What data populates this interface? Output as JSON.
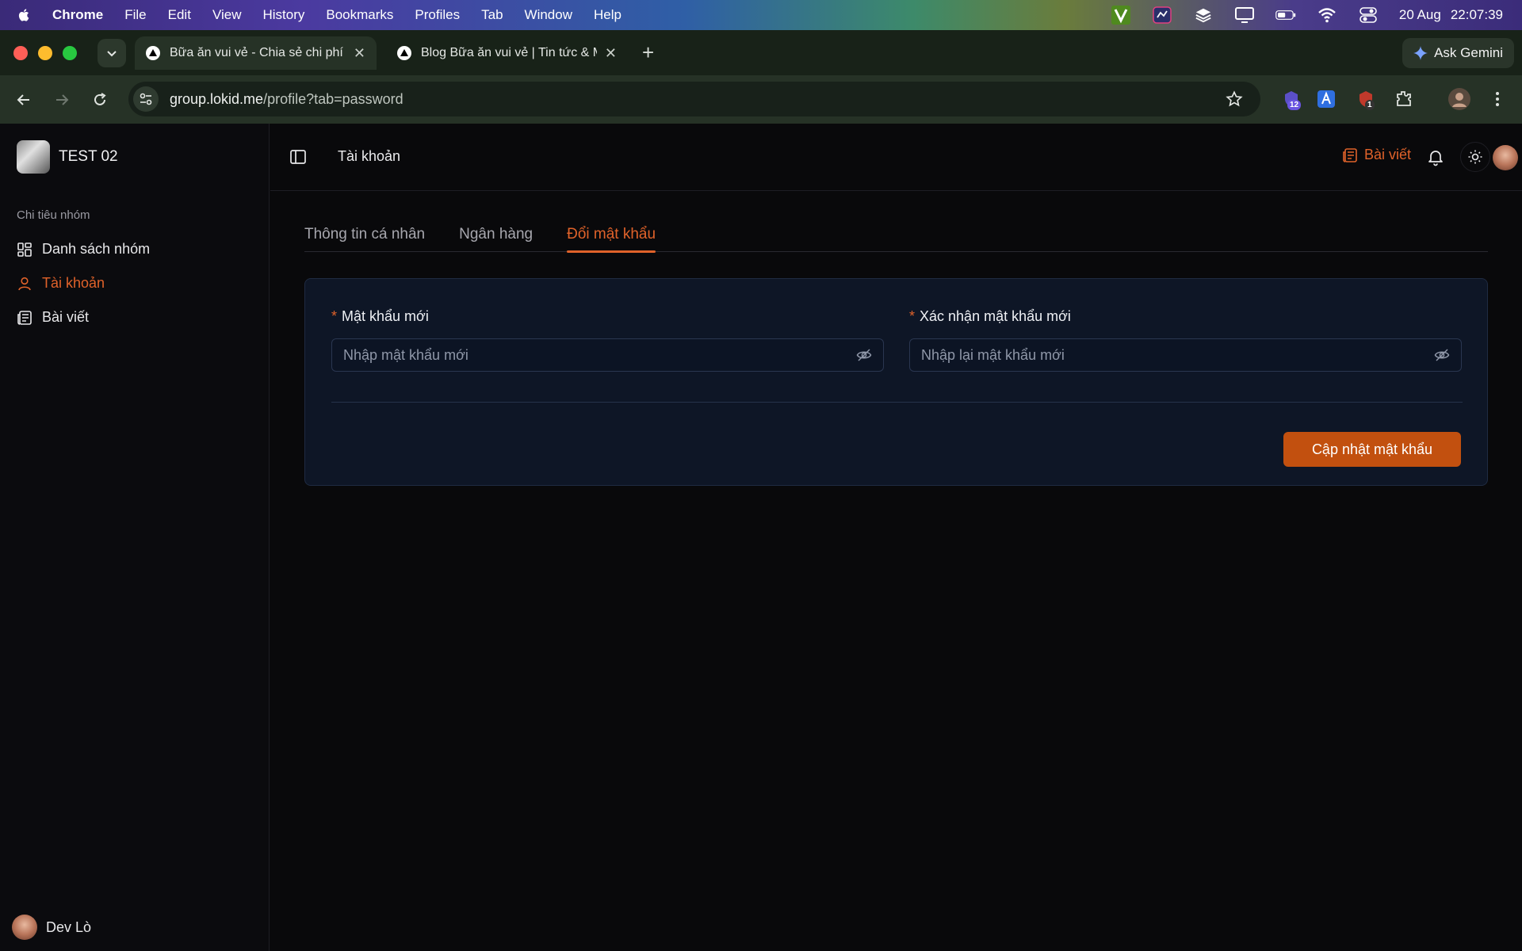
{
  "menubar": {
    "app": "Chrome",
    "items": [
      "File",
      "Edit",
      "View",
      "History",
      "Bookmarks",
      "Profiles",
      "Tab",
      "Window",
      "Help"
    ],
    "date": "20 Aug",
    "time": "22:07:39",
    "tray_icons": [
      "v-app-icon",
      "screen-tool-icon",
      "layers-icon",
      "display-icon",
      "battery-icon",
      "wifi-icon",
      "control-center-icon"
    ]
  },
  "browser": {
    "tabs": [
      {
        "title": "Bữa ăn vui vẻ - Chia sẻ chi phí",
        "active": true
      },
      {
        "title": "Blog Bữa ăn vui vẻ | Tin tức & Mẹo",
        "active": false
      }
    ],
    "gemini_label": "Ask Gemini",
    "url_host": "group.lokid.me",
    "url_path": "/profile?tab=password",
    "ext_badges": {
      "ext1": "12",
      "ext3": "1"
    }
  },
  "sidebar": {
    "brand": "TEST 02",
    "group_label": "Chi tiêu nhóm",
    "items": [
      {
        "label": "Danh sách nhóm",
        "active": false
      },
      {
        "label": "Tài khoản",
        "active": true
      },
      {
        "label": "Bài viết",
        "active": false
      }
    ],
    "user_name": "Dev Lò"
  },
  "header": {
    "title": "Tài khoản",
    "posts_link": "Bài viết"
  },
  "profile_tabs": [
    {
      "label": "Thông tin cá nhân",
      "active": false
    },
    {
      "label": "Ngân hàng",
      "active": false
    },
    {
      "label": "Đổi mật khẩu",
      "active": true
    }
  ],
  "form": {
    "new_password": {
      "label": "Mật khẩu mới",
      "value": "",
      "placeholder": "Nhập mật khẩu mới"
    },
    "confirm_password": {
      "label": "Xác nhận mật khẩu mới",
      "value": "",
      "placeholder": "Nhập lại mật khẩu mới"
    },
    "required_mark": "*",
    "submit_label": "Cập nhật mật khẩu"
  },
  "colors": {
    "accent": "#e0622a",
    "button": "#c2500f",
    "card_bg": "#0e1626",
    "app_bg": "#09090b"
  }
}
